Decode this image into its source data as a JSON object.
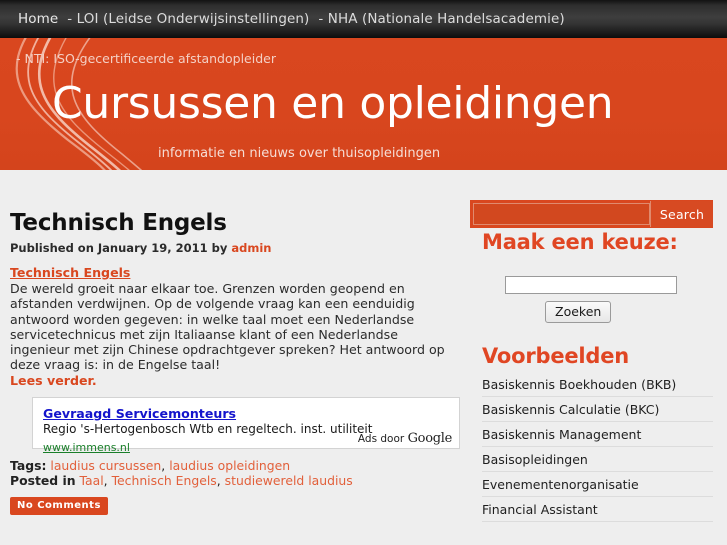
{
  "topnav": {
    "items": [
      {
        "label": "Home"
      },
      {
        "label": "- LOI (Leidse Onderwijsinstellingen)"
      },
      {
        "label": "- NHA (Nationale Handelsacademie)"
      }
    ]
  },
  "banner": {
    "tagline": "- NTI: ISO-gecertificeerde afstandopleider",
    "title": "Cursussen en opleidingen",
    "subtitle": "informatie en nieuws over thuisopleidingen",
    "bg_color": "#d9471f"
  },
  "search": {
    "value": "",
    "placeholder": "",
    "button_label": "Search"
  },
  "post": {
    "title": "Technisch Engels",
    "meta_prefix": "Published on January 19, 2011 by",
    "author": "admin",
    "excerpt_link": "Technisch Engels",
    "excerpt_body": "De wereld groeit naar elkaar toe. Grenzen worden geopend en afstanden verdwijnen. Op de volgende vraag kan een eenduidig antwoord worden gegeven: in welke taal moet een Nederlandse servicetechnicus met zijn Italiaanse klant of een Nederlandse ingenieur met zijn Chinese opdrachtgever spreken? Het antwoord op deze vraag is: in de Engelse taal!",
    "read_more": "Lees verder.",
    "tags_label": "Tags:",
    "tags": [
      "laudius cursussen",
      "laudius opleidingen"
    ],
    "posted_in_label": "Posted in",
    "categories": [
      "Taal",
      "Technisch Engels",
      "studiewereld laudius"
    ],
    "comments_badge": "No Comments"
  },
  "ad": {
    "title": "Gevraagd Servicemonteurs",
    "description": "Regio 's-Hertogenbosch Wtb en regeltech. inst. utiliteit",
    "url": "www.immens.nl",
    "byline_prefix": "Ads door",
    "byline_brand": "Google"
  },
  "sidebar": {
    "keuze_title": "Maak een keuze:",
    "keuze_input_value": "",
    "keuze_button_label": "Zoeken",
    "voorbeelden_title": "Voorbeelden",
    "voorbeelden": [
      "Basiskennis Boekhouden (BKB)",
      "Basiskennis Calculatie (BKC)",
      "Basiskennis Management",
      "Basisopleidingen",
      "Evenementenorganisatie",
      "Financial Assistant"
    ]
  },
  "colors": {
    "accent": "#d9471f",
    "accent_light": "#e2603b",
    "page_bg": "#eeeeee",
    "link_blue": "#1414cc",
    "link_green": "#1a7f2a"
  }
}
